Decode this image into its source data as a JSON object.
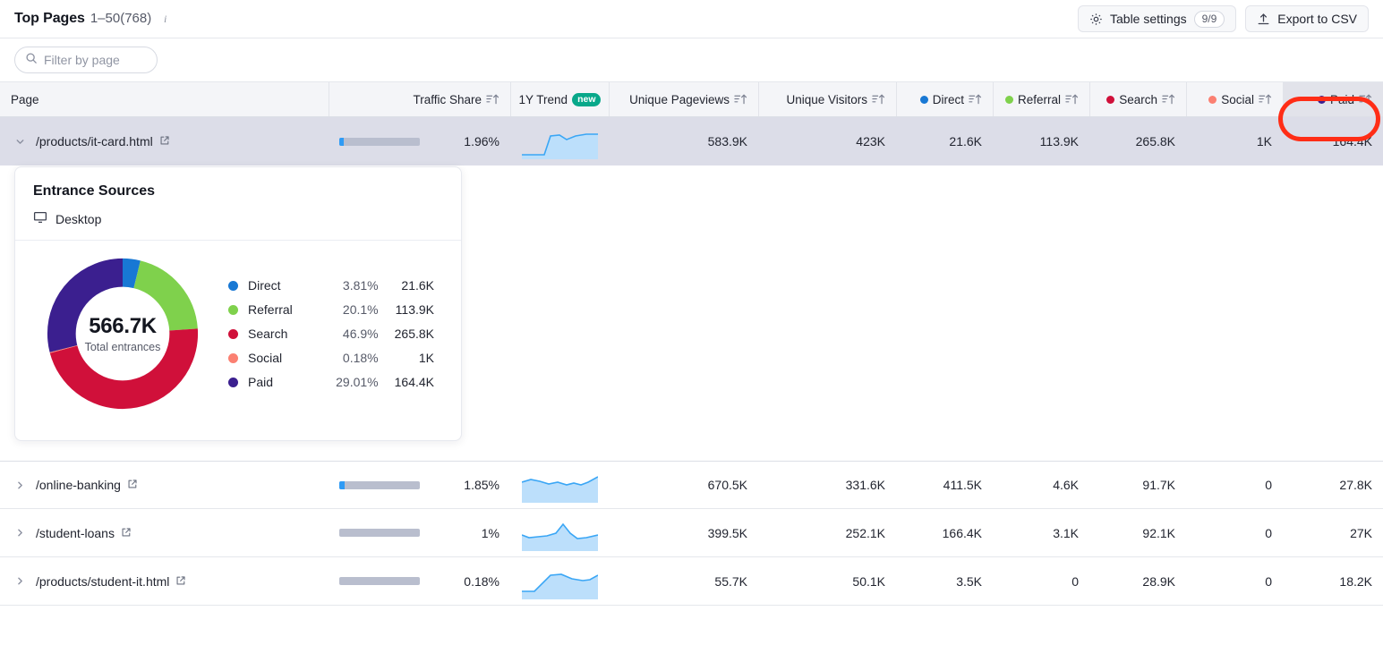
{
  "header": {
    "title": "Top Pages",
    "range": "1–50(768)",
    "info_icon": "info-icon",
    "table_settings_label": "Table settings",
    "table_settings_count": "9/9",
    "table_settings_icon": "gear-icon",
    "export_label": "Export to CSV",
    "export_icon": "upload-icon"
  },
  "filter": {
    "placeholder": "Filter by page",
    "value": "",
    "icon": "search-icon"
  },
  "columns": [
    {
      "key": "page",
      "label": "Page",
      "align": "left",
      "sortable": true,
      "dot": null
    },
    {
      "key": "share",
      "label": "Traffic Share",
      "align": "right",
      "sortable": true,
      "dot": null
    },
    {
      "key": "trend",
      "label": "1Y Trend",
      "align": "center",
      "sortable": false,
      "badge": "new",
      "dot": null
    },
    {
      "key": "upv",
      "label": "Unique Pageviews",
      "align": "right",
      "sortable": true,
      "dot": null
    },
    {
      "key": "uv",
      "label": "Unique Visitors",
      "align": "right",
      "sortable": true,
      "dot": null
    },
    {
      "key": "direct",
      "label": "Direct",
      "align": "right",
      "sortable": true,
      "dot": "#1878d4"
    },
    {
      "key": "referral",
      "label": "Referral",
      "align": "right",
      "sortable": true,
      "dot": "#7fd14c"
    },
    {
      "key": "search",
      "label": "Search",
      "align": "right",
      "sortable": true,
      "dot": "#d0103a"
    },
    {
      "key": "social",
      "label": "Social",
      "align": "right",
      "sortable": true,
      "dot": "#fb8072"
    },
    {
      "key": "paid",
      "label": "Paid",
      "align": "right",
      "sortable": true,
      "dot": "#3b1f8f",
      "highlighted": true
    }
  ],
  "rows": [
    {
      "page": "/products/it-card.html",
      "expanded": true,
      "share_pct": "1.96%",
      "share_fill": 6,
      "upv": "583.9K",
      "uv": "423K",
      "direct": "21.6K",
      "referral": "113.9K",
      "search": "265.8K",
      "social": "1K",
      "paid": "164.4K",
      "trend": [
        10,
        10,
        10,
        10,
        10,
        10,
        72,
        74,
        70,
        58,
        68,
        76,
        78
      ]
    },
    {
      "page": "/online-banking",
      "expanded": false,
      "share_pct": "1.85%",
      "share_fill": 7,
      "upv": "670.5K",
      "uv": "331.6K",
      "direct": "411.5K",
      "referral": "4.6K",
      "search": "91.7K",
      "social": "0",
      "paid": "27.8K",
      "trend": [
        60,
        66,
        62,
        58,
        62,
        55,
        58,
        62,
        58,
        54,
        60,
        70,
        78
      ]
    },
    {
      "page": "/student-loans",
      "expanded": false,
      "share_pct": "1%",
      "share_fill": 5,
      "upv": "399.5K",
      "uv": "252.1K",
      "direct": "166.4K",
      "referral": "3.1K",
      "search": "92.1K",
      "social": "0",
      "paid": "27K",
      "trend": [
        52,
        46,
        50,
        52,
        54,
        60,
        78,
        56,
        44,
        40,
        42,
        48,
        52
      ]
    },
    {
      "page": "/products/student-it.html",
      "expanded": false,
      "share_pct": "0.18%",
      "share_fill": 5,
      "upv": "55.7K",
      "uv": "50.1K",
      "direct": "3.5K",
      "referral": "0",
      "search": "28.9K",
      "social": "0",
      "paid": "18.2K",
      "trend": [
        10,
        10,
        22,
        48,
        68,
        70,
        66,
        60,
        54,
        50,
        50,
        58,
        62
      ]
    }
  ],
  "entrance_card": {
    "title": "Entrance Sources",
    "device": "Desktop",
    "device_icon": "desktop-icon",
    "total": "566.7K",
    "total_label": "Total entrances"
  },
  "chart_data": {
    "type": "pie",
    "title": "Entrance Sources",
    "subtitle": "Desktop",
    "center_value": "566.7K",
    "center_label": "Total entrances",
    "total": 566700,
    "legend_position": "right",
    "categories": [
      "Direct",
      "Referral",
      "Search",
      "Social",
      "Paid"
    ],
    "values": [
      3.81,
      20.1,
      46.9,
      0.18,
      29.01
    ],
    "value_labels": [
      "21.6K",
      "113.9K",
      "265.8K",
      "1K",
      "164.4K"
    ],
    "percent_labels": [
      "3.81%",
      "20.1%",
      "46.9%",
      "0.18%",
      "29.01%"
    ],
    "colors": [
      "#1878d4",
      "#7fd14c",
      "#d0103a",
      "#fb8072",
      "#3b1f8f"
    ],
    "ylabel": "",
    "xlabel": ""
  },
  "annotation": {
    "type": "highlight-ring",
    "color": "#ff2d16",
    "target": "Paid"
  }
}
